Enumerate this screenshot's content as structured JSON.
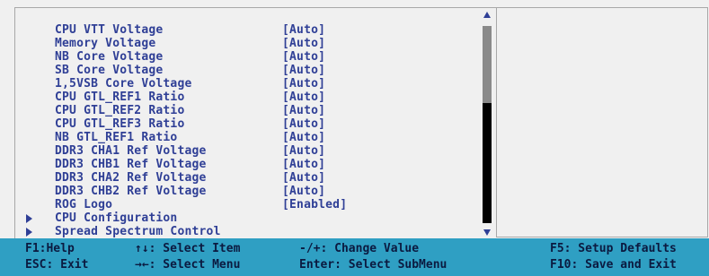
{
  "settings": [
    {
      "label": "CPU VTT Voltage",
      "value": "[Auto]"
    },
    {
      "label": "Memory Voltage",
      "value": "[Auto]"
    },
    {
      "label": "NB Core Voltage",
      "value": "[Auto]"
    },
    {
      "label": "SB Core Voltage",
      "value": "[Auto]"
    },
    {
      "label": "1,5VSB Core Voltage",
      "value": "[Auto]"
    },
    {
      "label": "CPU GTL_REF1 Ratio",
      "value": "[Auto]"
    },
    {
      "label": "CPU GTL_REF2 Ratio",
      "value": "[Auto]"
    },
    {
      "label": "CPU GTL_REF3 Ratio",
      "value": "[Auto]"
    },
    {
      "label": "NB GTL_REF1 Ratio",
      "value": "[Auto]"
    },
    {
      "label": "DDR3 CHA1 Ref Voltage",
      "value": "[Auto]"
    },
    {
      "label": "DDR3 CHB1 Ref Voltage",
      "value": "[Auto]"
    },
    {
      "label": "DDR3 CHA2 Ref Voltage",
      "value": "[Auto]"
    },
    {
      "label": "DDR3 CHB2 Ref Voltage",
      "value": "[Auto]"
    },
    {
      "label": "ROG Logo",
      "value": "[Enabled]"
    }
  ],
  "submenus": [
    {
      "label": "CPU Configuration",
      "icon": "submenu-arrow-icon"
    },
    {
      "label": "Spread Spectrum Control",
      "icon": "submenu-arrow-icon"
    }
  ],
  "scrollbar": {
    "position": 0.0,
    "visible_fraction": 0.39
  },
  "footer": {
    "help": "F1:Help",
    "select_item": "↑↓: Select Item",
    "change_value": "-/+: Change Value",
    "setup_defaults": "F5: Setup Defaults",
    "exit": "ESC: Exit",
    "select_menu": "→←: Select Menu",
    "select_submenu": "Enter: Select SubMenu",
    "save_exit": "F10: Save and Exit"
  },
  "colors": {
    "text": "#2f3f96",
    "footer_bg": "#2f9fc3",
    "background": "#f0f0f0",
    "footer_text": "#0b1a40"
  }
}
